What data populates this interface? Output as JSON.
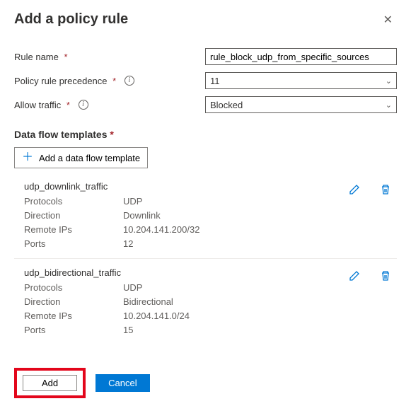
{
  "header": {
    "title": "Add a policy rule"
  },
  "form": {
    "ruleName": {
      "label": "Rule name",
      "value": "rule_block_udp_from_specific_sources"
    },
    "precedence": {
      "label": "Policy rule precedence",
      "value": "11"
    },
    "allowTraffic": {
      "label": "Allow traffic",
      "value": "Blocked"
    }
  },
  "section": {
    "heading": "Data flow templates",
    "addBtn": "Add a data flow template"
  },
  "templates": [
    {
      "name": "udp_downlink_traffic",
      "protocolsLabel": "Protocols",
      "protocols": "UDP",
      "directionLabel": "Direction",
      "direction": "Downlink",
      "remoteIpsLabel": "Remote IPs",
      "remoteIps": "10.204.141.200/32",
      "portsLabel": "Ports",
      "ports": "12"
    },
    {
      "name": "udp_bidirectional_traffic",
      "protocolsLabel": "Protocols",
      "protocols": "UDP",
      "directionLabel": "Direction",
      "direction": "Bidirectional",
      "remoteIpsLabel": "Remote IPs",
      "remoteIps": "10.204.141.0/24",
      "portsLabel": "Ports",
      "ports": "15"
    }
  ],
  "footer": {
    "add": "Add",
    "cancel": "Cancel"
  }
}
